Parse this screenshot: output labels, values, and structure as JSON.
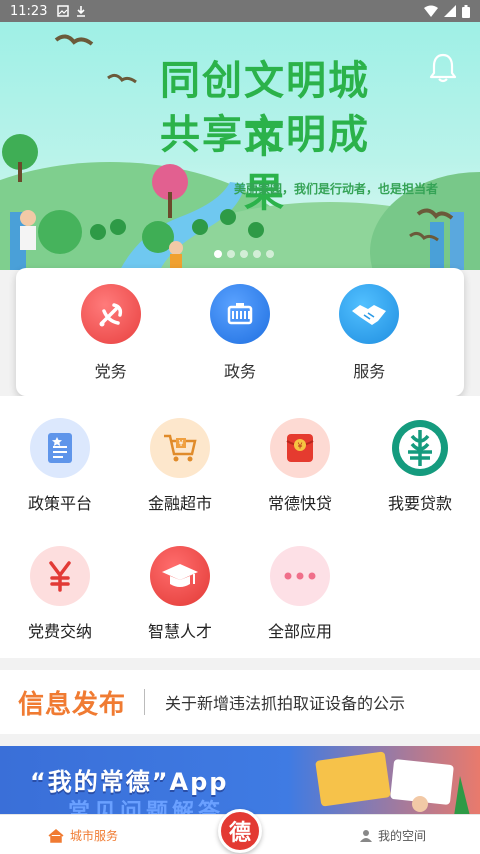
{
  "status_bar": {
    "time": "11:23"
  },
  "banner": {
    "title_line1": "同创文明城市",
    "title_line2": "共享文明成果",
    "slogan": "美丽家园，我们是行动者，也是担当者",
    "indicator_count": 5
  },
  "main_services": [
    {
      "label": "党务",
      "icon": "party-emblem-icon",
      "color": "#f05a5a"
    },
    {
      "label": "政务",
      "icon": "government-building-icon",
      "color": "#2f7fe8"
    },
    {
      "label": "服务",
      "icon": "handshake-icon",
      "color": "#2c9be6"
    }
  ],
  "apps": [
    {
      "label": "政策平台",
      "icon": "policy-document-icon",
      "bg": "#dfeafc"
    },
    {
      "label": "金融超市",
      "icon": "shopping-cart-icon",
      "bg": "#fde9cf"
    },
    {
      "label": "常德快贷",
      "icon": "red-envelope-icon",
      "bg": "#fdded9"
    },
    {
      "label": "我要贷款",
      "icon": "agricultural-bank-icon",
      "bg": "#ffffff"
    },
    {
      "label": "党费交纳",
      "icon": "yuan-icon",
      "bg": "#fde0df"
    },
    {
      "label": "智慧人才",
      "icon": "graduation-cap-icon",
      "bg": "#ea4d4d"
    },
    {
      "label": "全部应用",
      "icon": "more-dots-icon",
      "bg": "#fde0e6"
    }
  ],
  "news": {
    "section_title": "信息发布",
    "headline": "关于新增违法抓拍取证设备的公示"
  },
  "promo": {
    "text": "“我的常德”App",
    "subtext": "常见问题解答"
  },
  "bottom_nav": {
    "home_label": "城市服务",
    "center_label": "德",
    "space_label": "我的空间"
  }
}
